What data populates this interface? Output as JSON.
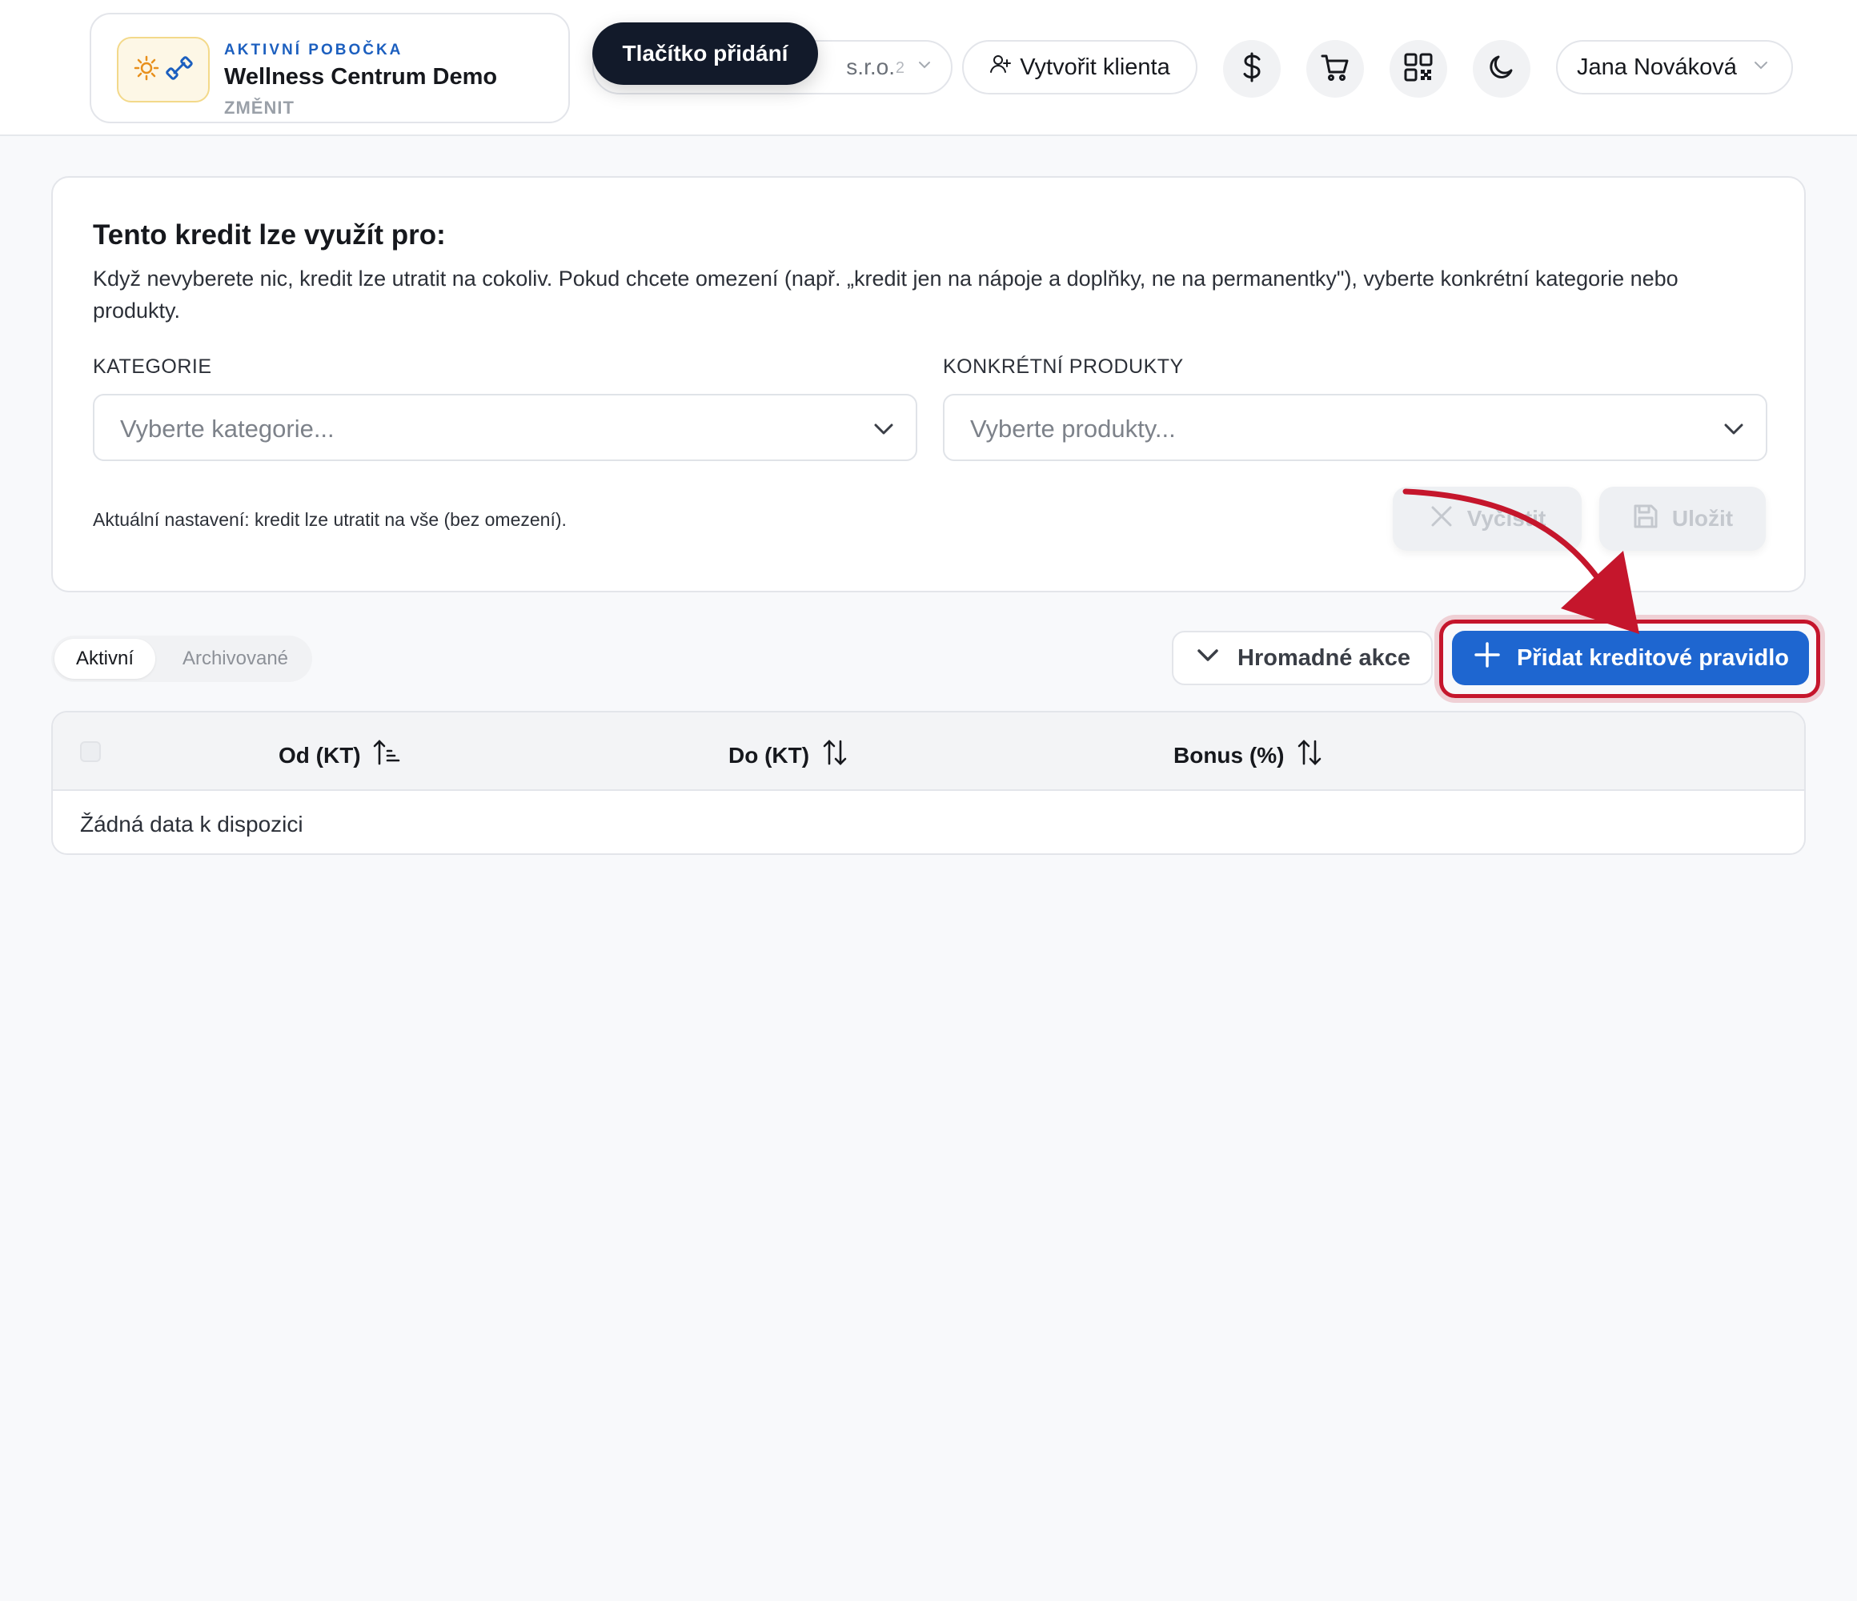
{
  "header": {
    "branch": {
      "eyebrow": "AKTIVNÍ POBOČKA",
      "name": "Wellness Centrum Demo",
      "change_label": "ZMĚNIT"
    },
    "company": {
      "name_visible": "s.r.o.",
      "count": "2"
    },
    "tooltip": "Tlačítko přidání",
    "create_client_label": "Vytvořit klienta",
    "icons": [
      "dollar-icon",
      "cart-icon",
      "qr-code-icon",
      "moon-icon"
    ],
    "user_name": "Jana Nováková"
  },
  "credit_settings": {
    "title": "Tento kredit lze využít pro:",
    "description": "Když nevyberete nic, kredit lze utratit na cokoliv. Pokud chcete omezení (např. „kredit jen na nápoje a doplňky, ne na permanentky\"), vyberte konkrétní kategorie nebo produkty.",
    "categories": {
      "label": "KATEGORIE",
      "placeholder": "Vyberte kategorie..."
    },
    "products": {
      "label": "KONKRÉTNÍ PRODUKTY",
      "placeholder": "Vyberte produkty..."
    },
    "current_setting": "Aktuální nastavení: kredit lze utratit na vše (bez omezení).",
    "clear_label": "Vyčistit",
    "save_label": "Uložit"
  },
  "toolbar": {
    "tabs": [
      {
        "label": "Aktivní",
        "active": true
      },
      {
        "label": "Archivované",
        "active": false
      }
    ],
    "bulk_label": "Hromadné akce",
    "add_label": "Přidat kreditové pravidlo"
  },
  "table": {
    "columns": [
      {
        "label": "Od (KT)",
        "sort": "ascending"
      },
      {
        "label": "Do (KT)",
        "sort": "none"
      },
      {
        "label": "Bonus (%)",
        "sort": "none"
      }
    ],
    "empty_text": "Žádná data k dispozici"
  },
  "colors": {
    "primary": "#1e66d0",
    "annotation": "#c5162c",
    "tooltip_bg": "#121a2a",
    "brand_blue": "#1c5fbf"
  }
}
